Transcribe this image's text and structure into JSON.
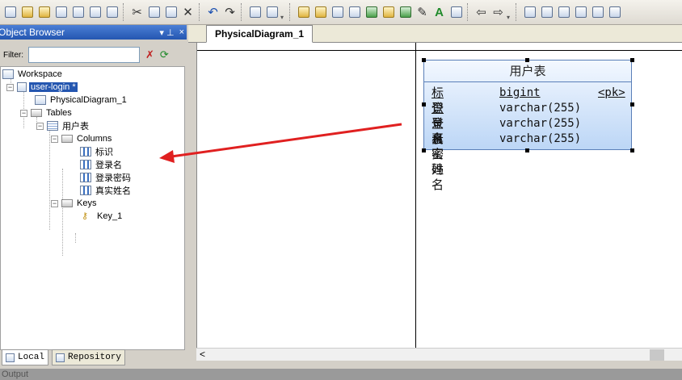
{
  "toolbar": {
    "icons": [
      "new-icon",
      "open-icon",
      "open-folder-icon",
      "save-icon",
      "save-all-icon",
      "print-preview-icon",
      "print-icon",
      "cut-icon",
      "copy-icon",
      "paste-icon",
      "delete-icon",
      "undo-icon",
      "redo-icon",
      "properties-icon",
      "find-icon",
      "table-icon",
      "view-icon",
      "reference-icon",
      "procedure-icon",
      "check-icon",
      "package-icon",
      "link-icon",
      "brush-icon",
      "text-icon",
      "tool-icon",
      "arrow-left-icon",
      "arrow-right-icon",
      "window1-icon",
      "window2-icon",
      "window3-icon",
      "window4-icon",
      "window5-icon",
      "window6-icon"
    ]
  },
  "object_browser": {
    "title": "Object Browser",
    "pin": "▾ ⊥",
    "close": "×",
    "filter_label": "Filter:",
    "filter_value": "",
    "tree": {
      "workspace": "Workspace",
      "model": "user-login *",
      "diagram": "PhysicalDiagram_1",
      "tables": "Tables",
      "table": "用户表",
      "columns": "Columns",
      "column_items": [
        "标识",
        "登录名",
        "登录密码",
        "真实姓名"
      ],
      "keys": "Keys",
      "key_items": [
        "Key_1"
      ]
    },
    "tabs": {
      "local": "Local",
      "repository": "Repository"
    }
  },
  "editor": {
    "tab_label": "PhysicalDiagram_1"
  },
  "entity": {
    "name": "用户表",
    "rows": [
      {
        "name": "标识",
        "type": "bigint",
        "key": "<pk>"
      },
      {
        "name": "登录名",
        "type": "varchar(255)",
        "key": ""
      },
      {
        "name": "登录密码",
        "type": "varchar(255)",
        "key": ""
      },
      {
        "name": "真实姓名",
        "type": "varchar(255)",
        "key": ""
      }
    ]
  },
  "output_panel": {
    "label": "Output"
  },
  "colors": {
    "annotation_arrow": "#e02020",
    "selection": "#2456b0",
    "panel_header": "#2456b0"
  }
}
